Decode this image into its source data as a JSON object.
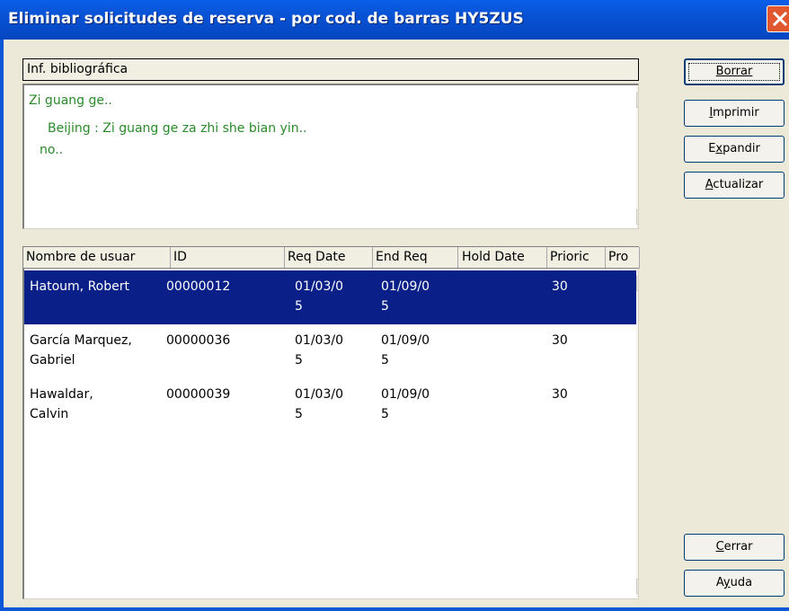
{
  "window": {
    "title": "Eliminar solicitudes de reserva - por cod. de barras HY5ZUS"
  },
  "bib_info": {
    "header": "Inf. bibliográfica",
    "lines": [
      "Zi guang ge..",
      "Beijing : Zi guang ge za zhi she bian yin..",
      "no.."
    ]
  },
  "table": {
    "columns": [
      "Nombre de usuar",
      "ID",
      "Req Date",
      "End Req",
      "Hold Date",
      "Prioric",
      "Pro"
    ],
    "rows": [
      {
        "name": "Hatoum, Robert",
        "id": "00000012",
        "req_date": "01/03/05",
        "end_req": "01/09/05",
        "hold_date": "",
        "priority": "30",
        "selected": true
      },
      {
        "name": "García Marquez, Gabriel",
        "id": "00000036",
        "req_date": "01/03/05",
        "end_req": "01/09/05",
        "hold_date": "",
        "priority": "30",
        "selected": false
      },
      {
        "name": "Hawaldar, Calvin",
        "id": "00000039",
        "req_date": "01/03/05",
        "end_req": "01/09/05",
        "hold_date": "",
        "priority": "30",
        "selected": false
      }
    ]
  },
  "buttons": {
    "borrar": {
      "label": "Borrar",
      "mnemonic": "B"
    },
    "imprimir": {
      "label": "Imprimir",
      "mnemonic": "I"
    },
    "expandir": {
      "label": "Expandir",
      "mnemonic": "x"
    },
    "actualizar": {
      "label": "Actualizar",
      "mnemonic": "A"
    },
    "cerrar": {
      "label": "Cerrar",
      "mnemonic": "C"
    },
    "ayuda": {
      "label": "Ayuda",
      "mnemonic": "y"
    }
  },
  "colors": {
    "titlebar": "#0852d4",
    "selection": "#0a1f87",
    "bib_text": "#2a8a2a",
    "close_button": "#e1572e"
  }
}
